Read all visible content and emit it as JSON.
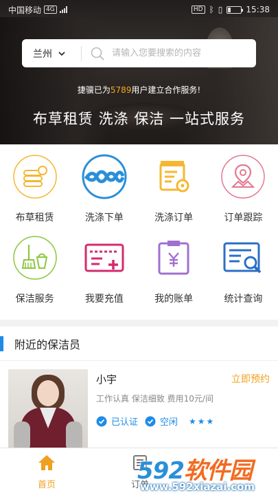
{
  "status": {
    "carrier": "中国移动",
    "network": "4G",
    "time": "15:38",
    "hd": "HD"
  },
  "search": {
    "city": "兰州",
    "placeholder": "请输入您要搜索的内容"
  },
  "promo": {
    "prefix": "捷骥已为",
    "count": "5789",
    "suffix": "用户建立合作服务!"
  },
  "slogan": "布草租赁 洗涤 保洁 一站式服务",
  "services": [
    {
      "label": "布草租赁",
      "icon": "linen-stack-icon",
      "color": "#f5b731"
    },
    {
      "label": "洗涤下单",
      "icon": "twisted-rope-icon",
      "color": "#2a8fd9"
    },
    {
      "label": "洗涤订单",
      "icon": "order-gear-icon",
      "color": "#f5b731"
    },
    {
      "label": "订单跟踪",
      "icon": "map-pin-icon",
      "color": "#e4768f"
    },
    {
      "label": "保洁服务",
      "icon": "broom-bucket-icon",
      "color": "#8cc63e"
    },
    {
      "label": "我要充值",
      "icon": "card-plus-icon",
      "color": "#d42a6e"
    },
    {
      "label": "我的账单",
      "icon": "bill-yen-icon",
      "color": "#a16fd0"
    },
    {
      "label": "统计查询",
      "icon": "stats-search-icon",
      "color": "#2a6fc5"
    }
  ],
  "nearby": {
    "title": "附近的保洁员",
    "cleaner": {
      "name": "小宇",
      "action": "立即预约",
      "desc": "工作认真 保洁细致 费用10元/间",
      "tags": [
        "已认证",
        "空闲"
      ],
      "rating": "★★★"
    }
  },
  "tabbar": {
    "items": [
      {
        "label": "首页"
      },
      {
        "label": "订单"
      }
    ]
  },
  "watermark": {
    "brand_a": "592",
    "brand_b": "软件园",
    "url": "www.592xiazai.com"
  },
  "colors": {
    "accent": "#f0a020",
    "blue": "#1e8ce6"
  }
}
